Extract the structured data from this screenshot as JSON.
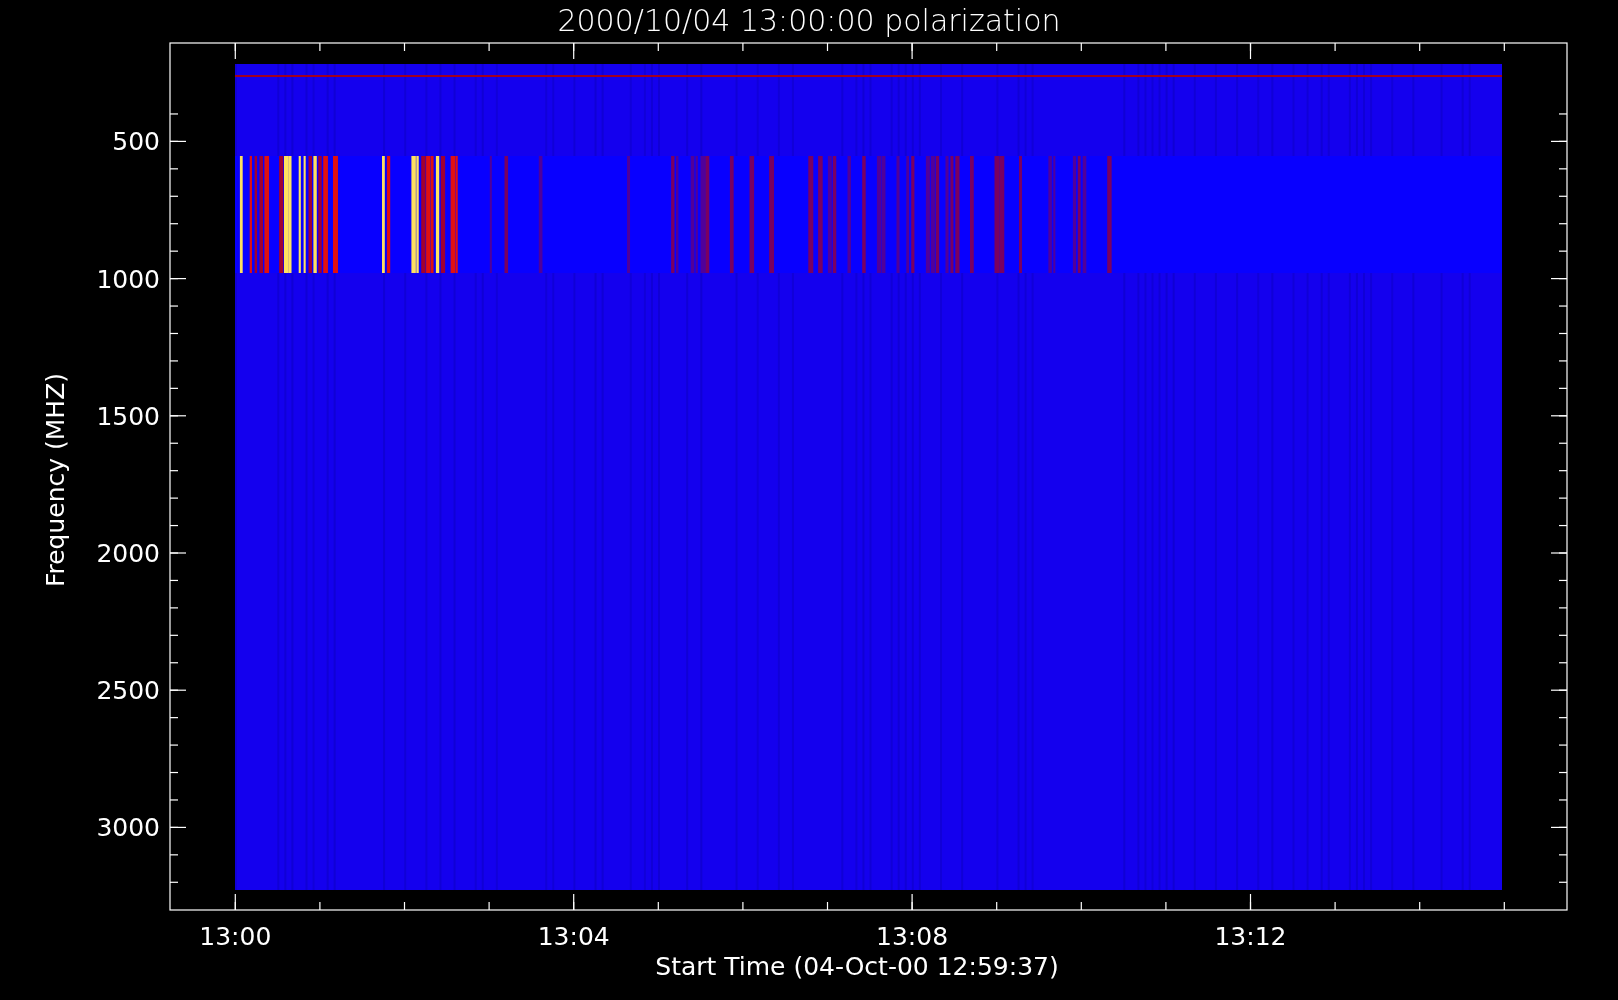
{
  "title": "2000/10/04 13:00:00 polarization",
  "ylabel": "Frequency (MHZ)",
  "xlabel": "Start Time (04-Oct-00 12:59:37)",
  "yticks": [
    "500",
    "1000",
    "1500",
    "2000",
    "2500",
    "3000"
  ],
  "xticks": [
    "13:00",
    "13:04",
    "13:08",
    "13:12"
  ]
}
